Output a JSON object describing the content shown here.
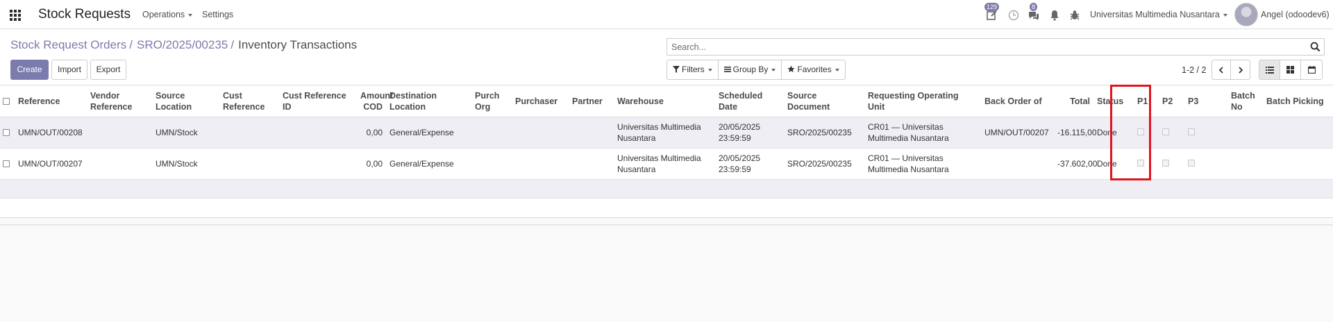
{
  "navbar": {
    "app_title": "Stock Requests",
    "menu_operations": "Operations",
    "menu_settings": "Settings",
    "activity_count": "129",
    "messages_count": "8",
    "company": "Universitas Multimedia Nusantara",
    "user": "Angel (odoodev6)"
  },
  "breadcrumb": {
    "item1": "Stock Request Orders",
    "item2": "SRO/2025/00235",
    "current": "Inventory Transactions",
    "separator": "/"
  },
  "search": {
    "placeholder": "Search..."
  },
  "buttons": {
    "create": "Create",
    "import": "Import",
    "export": "Export"
  },
  "filters": {
    "filters": "Filters",
    "group_by": "Group By",
    "favorites": "Favorites"
  },
  "pager": {
    "text": "1-2 / 2"
  },
  "table": {
    "headers": {
      "reference": "Reference",
      "vendor_reference": "Vendor Reference",
      "source_location": "Source Location",
      "cust_reference": "Cust Reference",
      "cust_reference_id": "Cust Reference ID",
      "amount_cod": "Amount COD",
      "destination_location": "Destination Location",
      "purch_org": "Purch Org",
      "purchaser": "Purchaser",
      "partner": "Partner",
      "warehouse": "Warehouse",
      "scheduled_date": "Scheduled Date",
      "source_document": "Source Document",
      "requesting_unit": "Requesting Operating Unit",
      "back_order_of": "Back Order of",
      "total": "Total",
      "status": "Status",
      "p1": "P1",
      "p2": "P2",
      "p3": "P3",
      "batch_no": "Batch No",
      "batch_picking": "Batch Picking"
    },
    "rows": [
      {
        "reference": "UMN/OUT/00208",
        "source_location": "UMN/Stock",
        "amount_cod": "0,00",
        "destination_location": "General/Expense",
        "warehouse": "Universitas Multimedia Nusantara",
        "scheduled_date": "20/05/2025 23:59:59",
        "source_document": "SRO/2025/00235",
        "requesting_unit": "CR01 — Universitas Multimedia Nusantara",
        "back_order_of": "UMN/OUT/00207",
        "total": "-16.115,00",
        "status": "Done"
      },
      {
        "reference": "UMN/OUT/00207",
        "source_location": "UMN/Stock",
        "amount_cod": "0,00",
        "destination_location": "General/Expense",
        "warehouse": "Universitas Multimedia Nusantara",
        "scheduled_date": "20/05/2025 23:59:59",
        "source_document": "SRO/2025/00235",
        "requesting_unit": "CR01 — Universitas Multimedia Nusantara",
        "back_order_of": "",
        "total": "-37.602,00",
        "status": "Done"
      }
    ]
  },
  "colors": {
    "brand": "#7c7bad",
    "highlight": "#e0141e",
    "odd_row": "#eeeef4"
  }
}
